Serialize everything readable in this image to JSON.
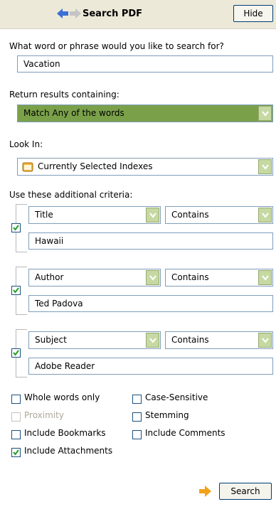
{
  "header": {
    "title": "Search PDF",
    "hide_label": "Hide"
  },
  "query": {
    "label": "What word or phrase would you like to search for?",
    "value": "Vacation"
  },
  "return_results": {
    "label": "Return results containing:",
    "selected": "Match Any of the words"
  },
  "look_in": {
    "label": "Look In:",
    "selected": "Currently Selected Indexes"
  },
  "criteria": {
    "label": "Use these additional criteria:",
    "rows": [
      {
        "field": "Title",
        "operator": "Contains",
        "value": "Hawaii",
        "checked": true
      },
      {
        "field": "Author",
        "operator": "Contains",
        "value": "Ted Padova",
        "checked": true
      },
      {
        "field": "Subject",
        "operator": "Contains",
        "value": "Adobe Reader",
        "checked": true
      }
    ]
  },
  "options": {
    "whole_words": {
      "label": "Whole words only",
      "checked": false
    },
    "case_sensitive": {
      "label": "Case-Sensitive",
      "checked": false
    },
    "proximity": {
      "label": "Proximity",
      "checked": false,
      "enabled": false
    },
    "stemming": {
      "label": "Stemming",
      "checked": false
    },
    "include_bookmarks": {
      "label": "Include Bookmarks",
      "checked": false
    },
    "include_comments": {
      "label": "Include Comments",
      "checked": false
    },
    "include_attachments": {
      "label": "Include Attachments",
      "checked": true
    }
  },
  "search_button": {
    "label": "Search"
  },
  "colors": {
    "header_bg": "#ece9d8",
    "accent_green": "#7aa14a",
    "border_blue": "#7f9db9",
    "arrow_blue": "#3a6fd6",
    "arrow_orange": "#f2a21a"
  }
}
